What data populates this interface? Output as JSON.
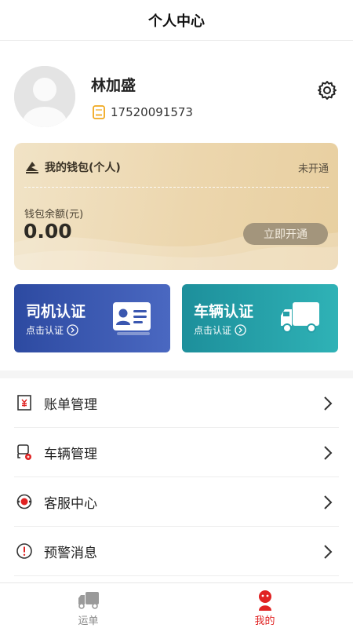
{
  "header": {
    "title": "个人中心"
  },
  "profile": {
    "name": "林加盛",
    "phone": "17520091573"
  },
  "wallet": {
    "title": "我的钱包(个人)",
    "status": "未开通",
    "balance_label": "钱包余额(元)",
    "balance": "0.00",
    "open_button": "立即开通"
  },
  "auth": {
    "driver": {
      "title": "司机认证",
      "sub": "点击认证"
    },
    "vehicle": {
      "title": "车辆认证",
      "sub": "点击认证"
    }
  },
  "menu": [
    {
      "label": "账单管理",
      "icon": "bill-icon"
    },
    {
      "label": "车辆管理",
      "icon": "vehicle-manage-icon"
    },
    {
      "label": "客服中心",
      "icon": "customer-service-icon"
    },
    {
      "label": "预警消息",
      "icon": "warning-icon"
    }
  ],
  "tabs": [
    {
      "label": "运单",
      "icon": "truck-icon",
      "active": false
    },
    {
      "label": "我的",
      "icon": "user-icon",
      "active": true
    }
  ],
  "colors": {
    "accent_red": "#e02222",
    "driver_card": "#3a57b0",
    "vehicle_card": "#25a0a8",
    "wallet_gold": "#ecd6ad"
  }
}
